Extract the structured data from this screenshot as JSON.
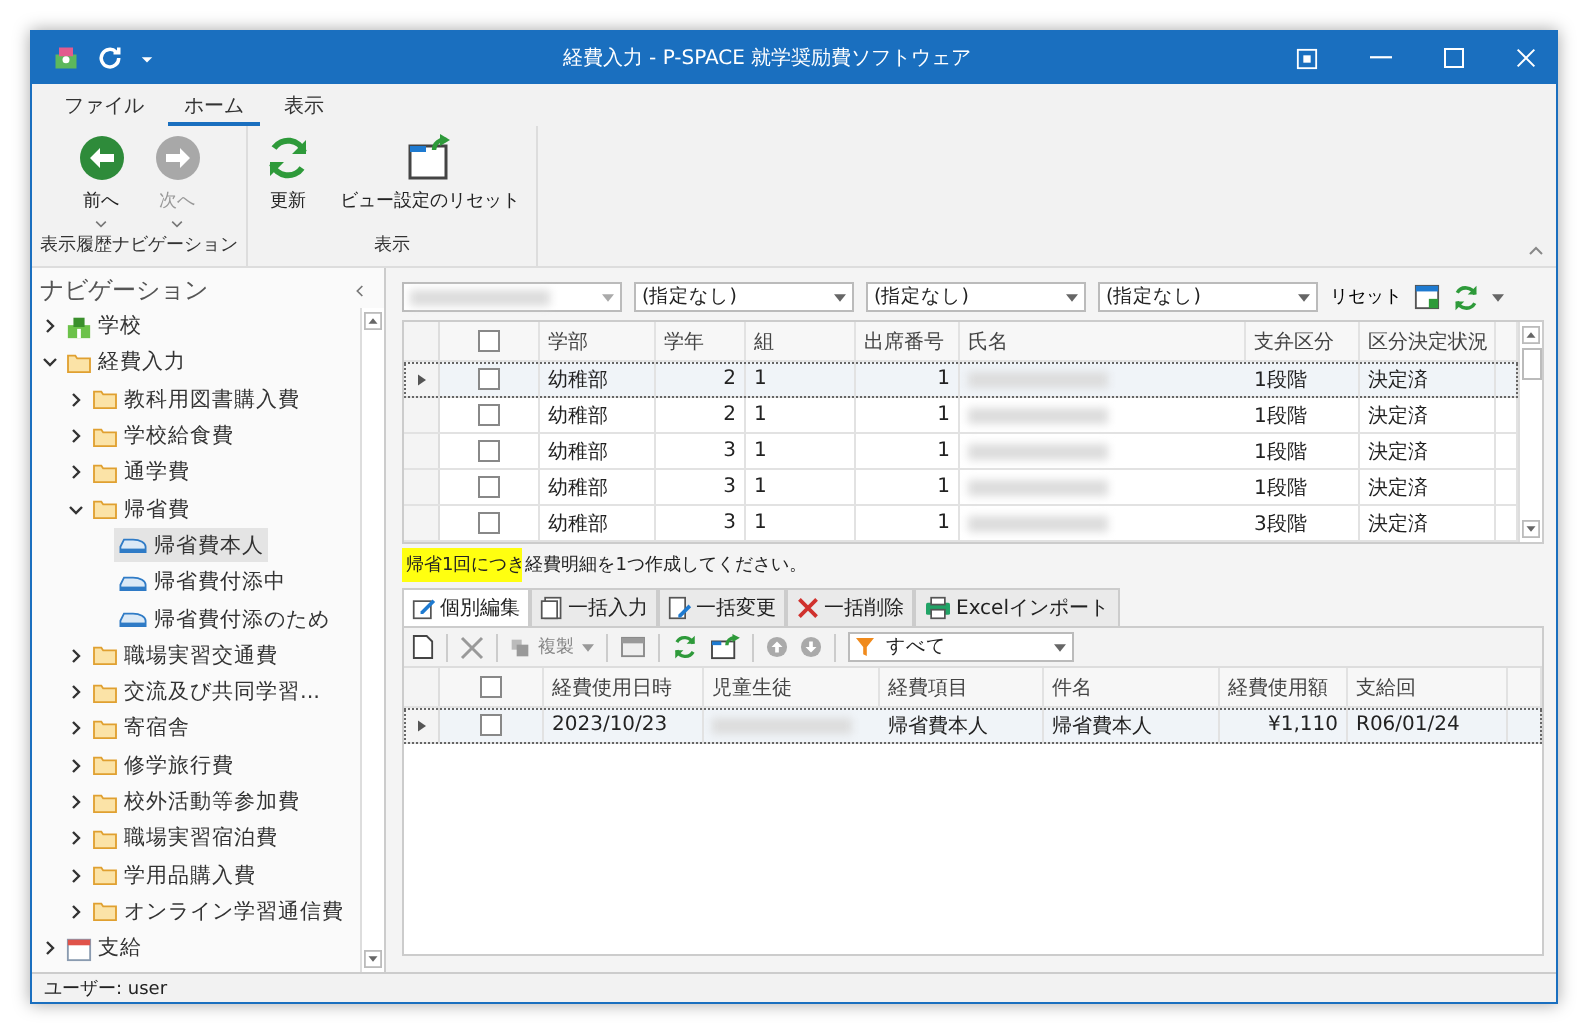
{
  "window": {
    "title": "経費入力 - P-SPACE 就学奨励費ソフトウェア"
  },
  "ribbon": {
    "tabs": [
      {
        "label": "ファイル",
        "selected": false
      },
      {
        "label": "ホーム",
        "selected": true
      },
      {
        "label": "表示",
        "selected": false
      }
    ],
    "groups": [
      {
        "label": "表示履歴ナビゲーション",
        "buttons": [
          {
            "kind": "back",
            "label": "前へ",
            "disabled": false,
            "dropdown": true
          },
          {
            "kind": "forward",
            "label": "次へ",
            "disabled": true,
            "dropdown": true
          }
        ]
      },
      {
        "label": "表示",
        "buttons": [
          {
            "kind": "refresh",
            "label": "更新",
            "disabled": false,
            "dropdown": false
          },
          {
            "kind": "reset-view",
            "label": "ビュー設定のリセット",
            "disabled": false,
            "dropdown": false
          }
        ]
      }
    ]
  },
  "navigation": {
    "title": "ナビゲーション",
    "items": [
      {
        "kind": "school",
        "label": "学校",
        "expanded": false,
        "selected": false
      },
      {
        "kind": "folder",
        "label": "経費入力",
        "expanded": true,
        "selected": false,
        "children": [
          {
            "kind": "folder",
            "label": "教科用図書購入費",
            "expanded": false,
            "selected": false
          },
          {
            "kind": "folder",
            "label": "学校給食費",
            "expanded": false,
            "selected": false
          },
          {
            "kind": "folder",
            "label": "通学費",
            "expanded": false,
            "selected": false
          },
          {
            "kind": "folder",
            "label": "帰省費",
            "expanded": true,
            "selected": false,
            "children": [
              {
                "kind": "leaf",
                "label": "帰省費本人",
                "selected": true
              },
              {
                "kind": "leaf",
                "label": "帰省費付添中",
                "selected": false
              },
              {
                "kind": "leaf",
                "label": "帰省費付添のため",
                "selected": false
              }
            ]
          },
          {
            "kind": "folder",
            "label": "職場実習交通費",
            "expanded": false,
            "selected": false
          },
          {
            "kind": "folder",
            "label": "交流及び共同学習...",
            "expanded": false,
            "selected": false
          },
          {
            "kind": "folder",
            "label": "寄宿舎",
            "expanded": false,
            "selected": false
          },
          {
            "kind": "folder",
            "label": "修学旅行費",
            "expanded": false,
            "selected": false
          },
          {
            "kind": "folder",
            "label": "校外活動等参加費",
            "expanded": false,
            "selected": false
          },
          {
            "kind": "folder",
            "label": "職場実習宿泊費",
            "expanded": false,
            "selected": false
          },
          {
            "kind": "folder",
            "label": "学用品購入費",
            "expanded": false,
            "selected": false
          },
          {
            "kind": "folder",
            "label": "オンライン学習通信費",
            "expanded": false,
            "selected": false
          }
        ]
      },
      {
        "kind": "calendar",
        "label": "支給",
        "expanded": false,
        "selected": false
      }
    ]
  },
  "filters": {
    "dropdowns": [
      "(指定なし)",
      "(指定なし)",
      "(指定なし)"
    ],
    "reset_label": "リセット"
  },
  "students_table": {
    "all_checked": false,
    "columns": [
      "学部",
      "学年",
      "組",
      "出席番号",
      "氏名",
      "支弁区分",
      "区分決定状況"
    ],
    "rows": [
      {
        "current": true,
        "checked": false,
        "cells": [
          "幼稚部",
          "2",
          "1",
          "1",
          "",
          "1段階",
          "決定済"
        ]
      },
      {
        "current": false,
        "checked": false,
        "cells": [
          "幼稚部",
          "2",
          "1",
          "1",
          "",
          "1段階",
          "決定済"
        ]
      },
      {
        "current": false,
        "checked": false,
        "cells": [
          "幼稚部",
          "3",
          "1",
          "1",
          "",
          "1段階",
          "決定済"
        ]
      },
      {
        "current": false,
        "checked": false,
        "cells": [
          "幼稚部",
          "3",
          "1",
          "1",
          "",
          "1段階",
          "決定済"
        ]
      },
      {
        "current": false,
        "checked": false,
        "cells": [
          "幼稚部",
          "3",
          "1",
          "1",
          "",
          "3段階",
          "決定済"
        ]
      }
    ]
  },
  "message": "帰省1回につき経費明細を1つ作成してください。",
  "edit_tabs": [
    {
      "kind": "edit",
      "label": "個別編集",
      "selected": true
    },
    {
      "kind": "bulk-input",
      "label": "一括入力",
      "selected": false
    },
    {
      "kind": "bulk-change",
      "label": "一括変更",
      "selected": false
    },
    {
      "kind": "bulk-delete",
      "label": "一括削除",
      "selected": false
    },
    {
      "kind": "excel",
      "label": "Excelインポート",
      "selected": false
    }
  ],
  "toolbar": {
    "duplicate_label": "複製",
    "filter_value": "すべて"
  },
  "expenses_table": {
    "all_checked": false,
    "columns": [
      "経費使用日時",
      "児童生徒",
      "経費項目",
      "件名",
      "経費使用額",
      "支給回"
    ],
    "rows": [
      {
        "current": true,
        "checked": false,
        "cells": [
          "2023/10/23",
          "",
          "帰省費本人",
          "帰省費本人",
          "¥1,110",
          "R06/01/24"
        ]
      }
    ]
  },
  "status_bar": {
    "user": "ユーザー: user"
  }
}
